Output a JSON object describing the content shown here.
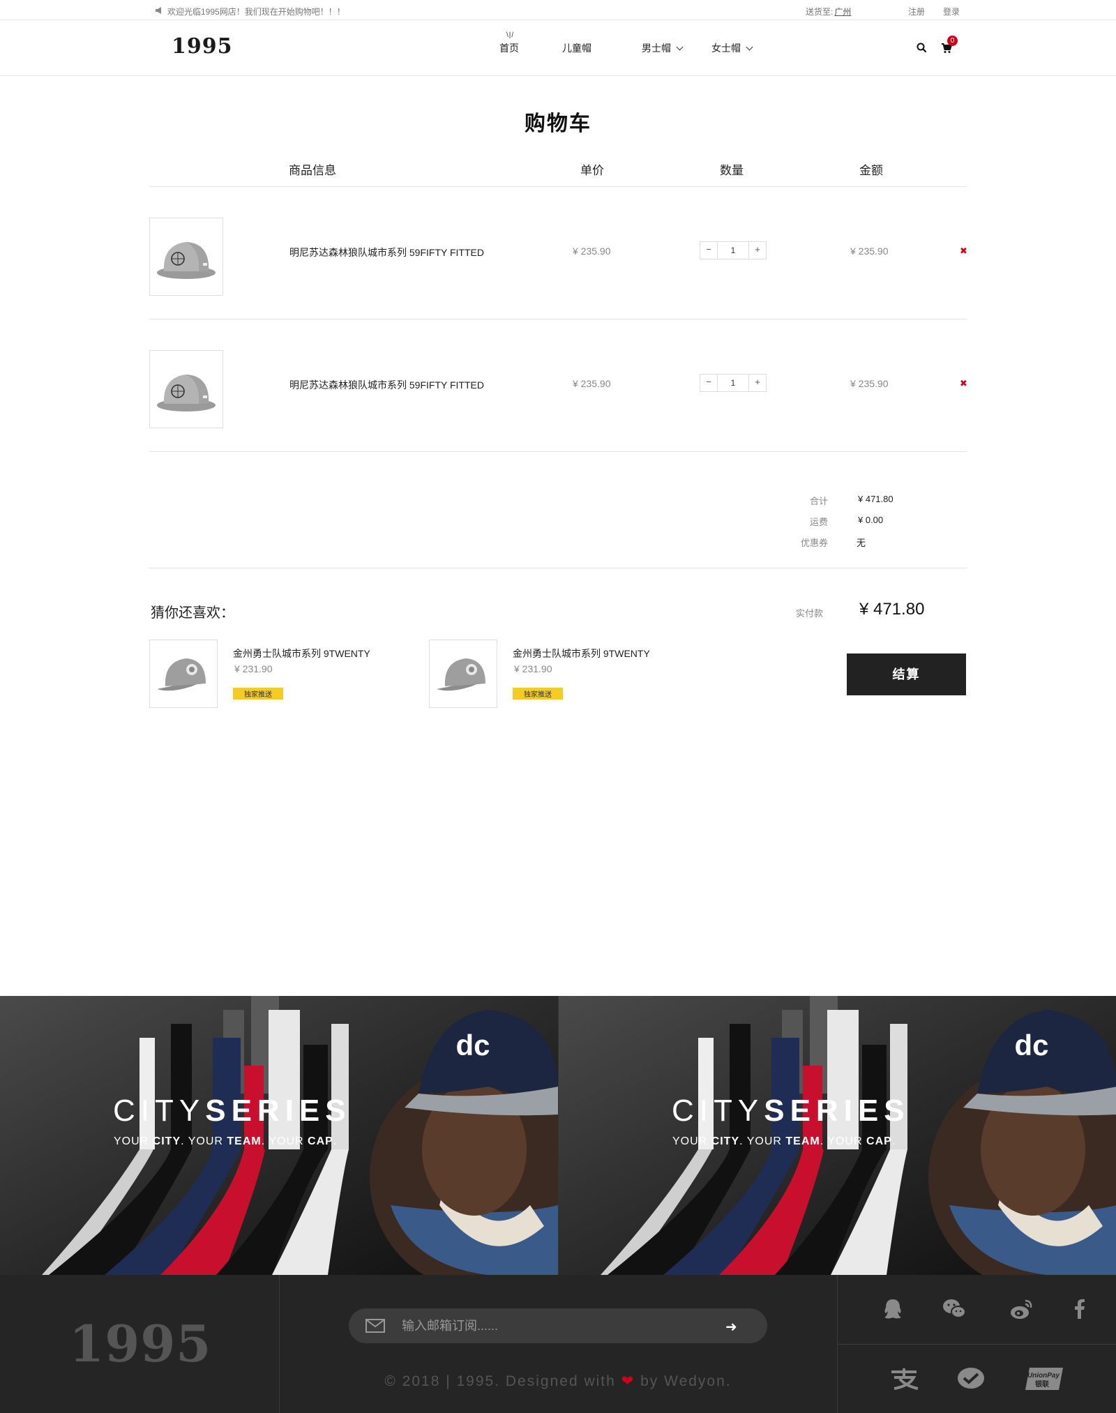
{
  "topbar": {
    "notice": "欢迎光临1995网店！我们现在开始购物吧！！！",
    "ship_label": "送货至:",
    "ship_city": "广州",
    "register": "注册",
    "login": "登录"
  },
  "header": {
    "logo": "1995",
    "nav": [
      {
        "label": "首页"
      },
      {
        "label": "儿童帽"
      },
      {
        "label": "男士帽"
      },
      {
        "label": "女士帽"
      }
    ],
    "cart_count": "0"
  },
  "cart": {
    "title": "购物车",
    "columns": [
      "商品信息",
      "单价",
      "数量",
      "金额"
    ],
    "items": [
      {
        "name": "明尼苏达森林狼队城市系列 59FIFTY FITTED",
        "price": "¥ 235.90",
        "qty": "1",
        "amount": "¥ 235.90"
      },
      {
        "name": "明尼苏达森林狼队城市系列 59FIFTY FITTED",
        "price": "¥ 235.90",
        "qty": "1",
        "amount": "¥ 235.90"
      }
    ],
    "summary": {
      "subtotal_label": "合计",
      "subtotal": "¥ 471.80",
      "shipping_label": "运费",
      "shipping": "¥ 0.00",
      "coupon_label": "优惠券",
      "coupon": "无"
    },
    "pay_label": "实付款",
    "pay_total": "¥ 471.80",
    "checkout": "结算"
  },
  "recommend": {
    "title": "猜你还喜欢：",
    "items": [
      {
        "name": "金州勇士队城市系列 9TWENTY",
        "price": "¥ 231.90",
        "tag": "独家推送"
      },
      {
        "name": "金州勇士队城市系列 9TWENTY",
        "price": "¥ 231.90",
        "tag": "独家推送"
      }
    ]
  },
  "banner": {
    "headline_light": "CITY",
    "headline_bold": "SERIES",
    "tagline_1": "YOUR ",
    "tagline_city": "CITY",
    "tagline_2": ". YOUR ",
    "tagline_team": "TEAM",
    "tagline_3": ". YOUR ",
    "tagline_cap": "CAP",
    "tagline_4": ".",
    "cap_logo": "dc"
  },
  "footer": {
    "logo": "1995",
    "subscribe_placeholder": "输入邮箱订阅......",
    "copyright_1": "© 2018 | 1995. Designed with",
    "copyright_2": "by Wedyon.",
    "unionpay_en": "UnionPay",
    "unionpay_cn": "银联"
  },
  "colors": {
    "accent_red": "#d0021b",
    "tag_yellow": "#f6cc24",
    "footer_bg": "#252525",
    "button_dark": "#222222"
  }
}
